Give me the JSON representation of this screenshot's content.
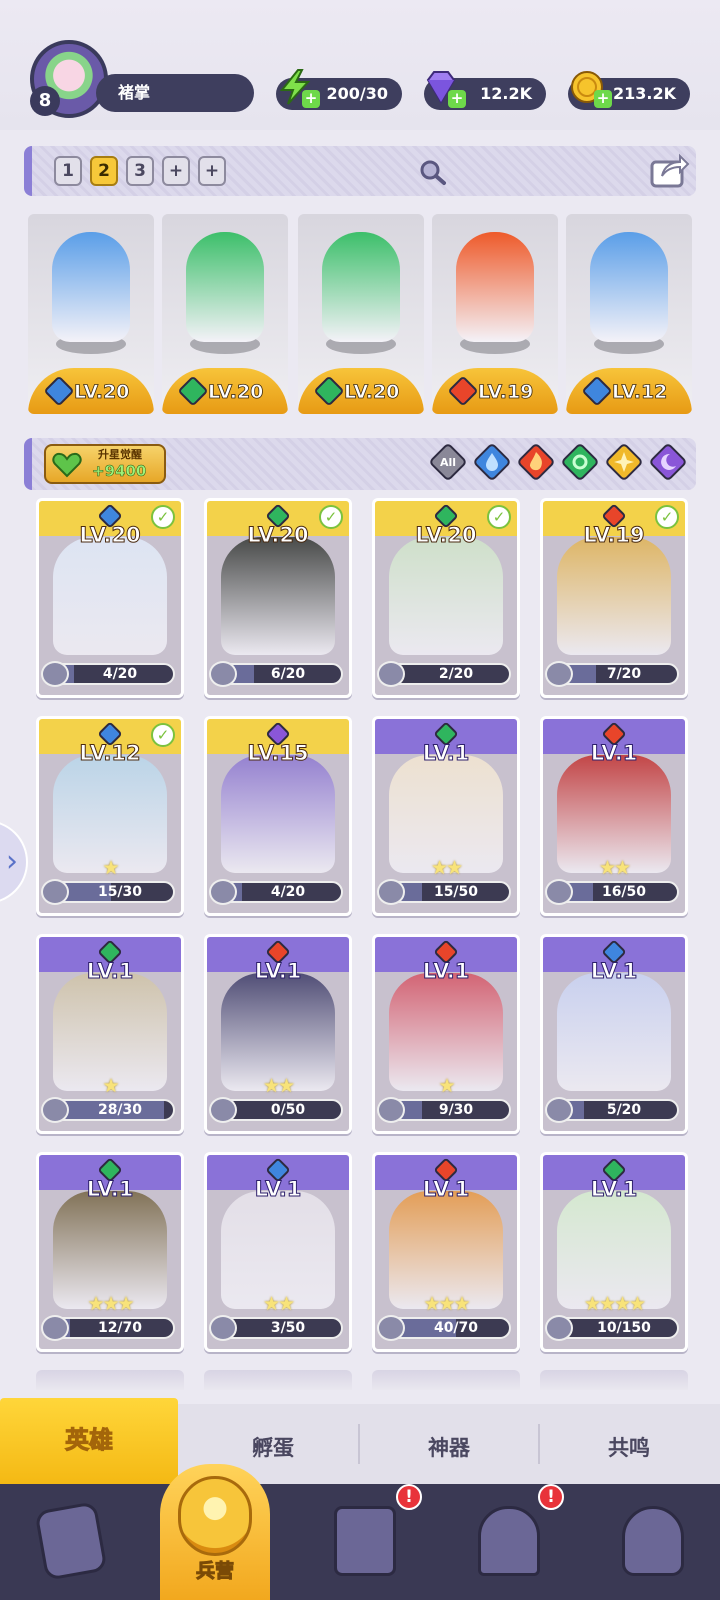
{
  "player": {
    "level": "8",
    "name": "褚掌"
  },
  "resources": {
    "energy": "200/30",
    "gems": "12.2K",
    "coins": "213.2K"
  },
  "team_tabs": [
    "1",
    "2",
    "3",
    "+",
    "+"
  ],
  "team_active_index": 1,
  "deployed_heroes": [
    {
      "level": "LV.20",
      "element": "water",
      "color": "#5a9ee8"
    },
    {
      "level": "LV.20",
      "element": "nature",
      "color": "#3cbf6a"
    },
    {
      "level": "LV.20",
      "element": "nature",
      "color": "#3cbf6a"
    },
    {
      "level": "LV.19",
      "element": "fire",
      "color": "#ee5a2a"
    },
    {
      "level": "LV.12",
      "element": "water",
      "color": "#5a9ee8"
    }
  ],
  "awaken": {
    "title": "升星觉醒",
    "value": "+9400"
  },
  "filters": [
    "All",
    "water",
    "fire",
    "nature",
    "light",
    "dark"
  ],
  "element_colors": {
    "water": "#3f86de",
    "fire": "#e8452a",
    "nature": "#2fb55e",
    "light": "#f0b92a",
    "dark": "#8a56d8"
  },
  "heroes": [
    {
      "level": "LV.20",
      "element": "water",
      "tier": "gold",
      "checked": true,
      "stars": "",
      "shards": "4/20",
      "fill": 0.2,
      "art": "#dfe8f7"
    },
    {
      "level": "LV.20",
      "element": "nature",
      "tier": "gold",
      "checked": true,
      "stars": "",
      "shards": "6/20",
      "fill": 0.3,
      "art": "#3a3d3a"
    },
    {
      "level": "LV.20",
      "element": "nature",
      "tier": "gold",
      "checked": true,
      "stars": "",
      "shards": "2/20",
      "fill": 0.1,
      "art": "#cfe3c9"
    },
    {
      "level": "LV.19",
      "element": "fire",
      "tier": "gold",
      "checked": true,
      "stars": "",
      "shards": "7/20",
      "fill": 0.35,
      "art": "#e0b45a"
    },
    {
      "level": "LV.12",
      "element": "water",
      "tier": "gold",
      "checked": true,
      "stars": "★",
      "shards": "15/30",
      "fill": 0.5,
      "art": "#b9d6ea"
    },
    {
      "level": "LV.15",
      "element": "dark",
      "tier": "gold",
      "checked": false,
      "stars": "",
      "shards": "4/20",
      "fill": 0.2,
      "art": "#8f7ad0"
    },
    {
      "level": "LV.1",
      "element": "nature",
      "tier": "purple",
      "checked": false,
      "stars": "★★",
      "shards": "15/50",
      "fill": 0.3,
      "art": "#f1e4d0"
    },
    {
      "level": "LV.1",
      "element": "fire",
      "tier": "purple",
      "checked": false,
      "stars": "★★",
      "shards": "16/50",
      "fill": 0.32,
      "art": "#c23838"
    },
    {
      "level": "LV.1",
      "element": "nature",
      "tier": "purple",
      "checked": false,
      "stars": "★",
      "shards": "28/30",
      "fill": 0.93,
      "art": "#cfc3a8"
    },
    {
      "level": "LV.1",
      "element": "fire",
      "tier": "purple",
      "checked": false,
      "stars": "★★",
      "shards": "0/50",
      "fill": 0.0,
      "art": "#43416c"
    },
    {
      "level": "LV.1",
      "element": "fire",
      "tier": "purple",
      "checked": false,
      "stars": "★",
      "shards": "9/30",
      "fill": 0.3,
      "art": "#d45a6a"
    },
    {
      "level": "LV.1",
      "element": "water",
      "tier": "purple",
      "checked": false,
      "stars": "",
      "shards": "5/20",
      "fill": 0.25,
      "art": "#c9d2f2"
    },
    {
      "level": "LV.1",
      "element": "nature",
      "tier": "purple",
      "checked": false,
      "stars": "★★★",
      "shards": "12/70",
      "fill": 0.17,
      "art": "#7a6a4a"
    },
    {
      "level": "LV.1",
      "element": "water",
      "tier": "purple",
      "checked": false,
      "stars": "★★",
      "shards": "3/50",
      "fill": 0.06,
      "art": "#e6e2ea"
    },
    {
      "level": "LV.1",
      "element": "fire",
      "tier": "purple",
      "checked": false,
      "stars": "★★★",
      "shards": "40/70",
      "fill": 0.57,
      "art": "#e69a4a"
    },
    {
      "level": "LV.1",
      "element": "nature",
      "tier": "purple",
      "checked": false,
      "stars": "★★★★",
      "shards": "10/150",
      "fill": 0.07,
      "art": "#d6ecd0"
    }
  ],
  "sub_tabs": [
    "英雄",
    "孵蛋",
    "神器",
    "共鸣"
  ],
  "nav": {
    "active_label": "兵营",
    "alert_mark": "!"
  }
}
